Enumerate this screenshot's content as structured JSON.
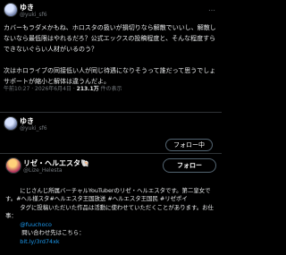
{
  "tweet": {
    "author_name": "ゆき",
    "author_handle": "@yuki_sf6",
    "more_label": "…",
    "text": "カバーもラダメかもね、ホロスタの扱いが損切りなら解散でいいし、解散しないなら最低限はやれるだろ？公式エックスの投稿程度と、そんな程度すらできないぐらい人材がいるのう？\n\n次はホロライブの同接低い人が同じ待遇になりそうって誰だって思うでしょ\nサポートが縮小と解体は違うんだよ。",
    "meta_prefix": "午前10:27 · 2026年6月4日 · ",
    "views": "213.1万",
    "views_suffix": " 件の表示"
  },
  "card": {
    "author_name": "ゆき",
    "author_handle": "@yuki_sf6",
    "follow_tab_label": "フォロー中"
  },
  "profile": {
    "name": "リゼ・ヘルエスタ🐚",
    "handle": "@Lize_Helesta",
    "follow_label": "フォロー",
    "bio_line1": "にじさんじ所属バーチャルYouTuberのリゼ・ヘルエスタです。第二皇女です。#ヘル様スタ#ヘルエスタ王国放送 #ヘルエスタ王国民 #リゼポイ",
    "bio_line2": "タグに投稿いただいた作品は活動に使わせていただくことがあります。お仕事：",
    "bio_link1": "@fuuchoco",
    "bio_mid": " 問い合わせ先はこちら：",
    "bio_link2": "bit.ly/3rd74xk"
  }
}
